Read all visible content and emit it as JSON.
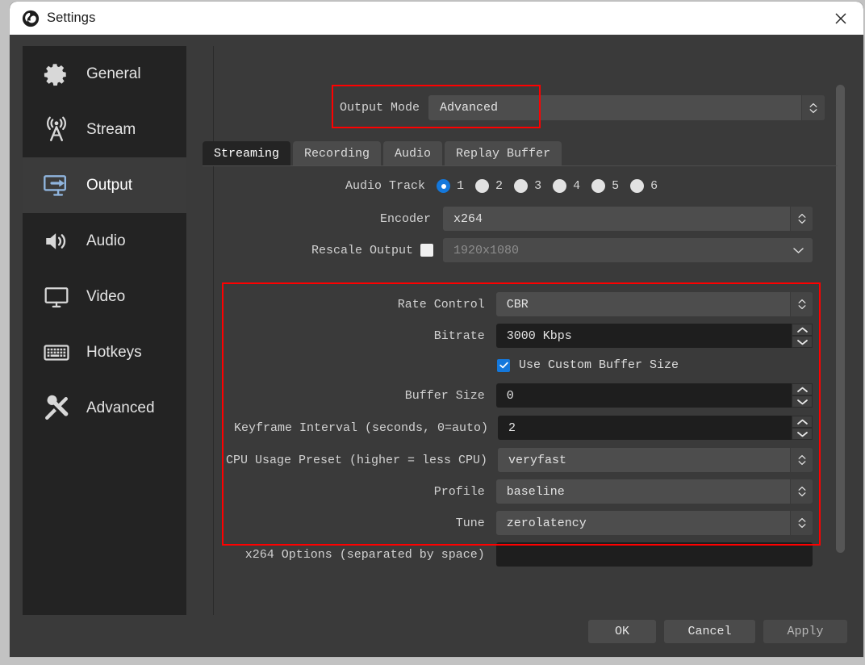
{
  "window": {
    "title": "Settings",
    "logo_icon": "obs-logo-icon",
    "close_icon": "close-icon"
  },
  "sidebar": {
    "items": [
      {
        "label": "General",
        "icon": "gear-icon",
        "active": false
      },
      {
        "label": "Stream",
        "icon": "broadcast-icon",
        "active": false
      },
      {
        "label": "Output",
        "icon": "output-monitor-arrow-icon",
        "active": true
      },
      {
        "label": "Audio",
        "icon": "speaker-icon",
        "active": false
      },
      {
        "label": "Video",
        "icon": "monitor-icon",
        "active": false
      },
      {
        "label": "Hotkeys",
        "icon": "keyboard-icon",
        "active": false
      },
      {
        "label": "Advanced",
        "icon": "wrench-screwdriver-icon",
        "active": false
      }
    ]
  },
  "output_mode": {
    "label": "Output Mode",
    "value": "Advanced",
    "highlighted": true
  },
  "tabs": [
    {
      "label": "Streaming",
      "active": true
    },
    {
      "label": "Recording",
      "active": false
    },
    {
      "label": "Audio",
      "active": false
    },
    {
      "label": "Replay Buffer",
      "active": false
    }
  ],
  "streaming": {
    "audio_track": {
      "label": "Audio Track",
      "options": [
        "1",
        "2",
        "3",
        "4",
        "5",
        "6"
      ],
      "selected": "1"
    },
    "encoder": {
      "label": "Encoder",
      "value": "x264"
    },
    "rescale_output": {
      "label": "Rescale Output",
      "checked": false,
      "value": "1920x1080",
      "disabled": true
    },
    "rate_control": {
      "label": "Rate Control",
      "value": "CBR"
    },
    "bitrate": {
      "label": "Bitrate",
      "value": "3000 Kbps"
    },
    "use_custom_buffer_size": {
      "label": "Use Custom Buffer Size",
      "checked": true
    },
    "buffer_size": {
      "label": "Buffer Size",
      "value": "0"
    },
    "keyframe_interval": {
      "label": "Keyframe Interval (seconds, 0=auto)",
      "value": "2"
    },
    "cpu_usage_preset": {
      "label": "CPU Usage Preset (higher = less CPU)",
      "value": "veryfast"
    },
    "profile": {
      "label": "Profile",
      "value": "baseline"
    },
    "tune": {
      "label": "Tune",
      "value": "zerolatency"
    },
    "x264_options": {
      "label": "x264 Options (separated by space)",
      "value": ""
    }
  },
  "buttons": {
    "ok": "OK",
    "cancel": "Cancel",
    "apply": "Apply"
  },
  "colors": {
    "accent_blue": "#1478dc",
    "highlight_red": "#ff0000",
    "window_bg": "#3a3a3a",
    "sidebar_bg": "#232323"
  }
}
